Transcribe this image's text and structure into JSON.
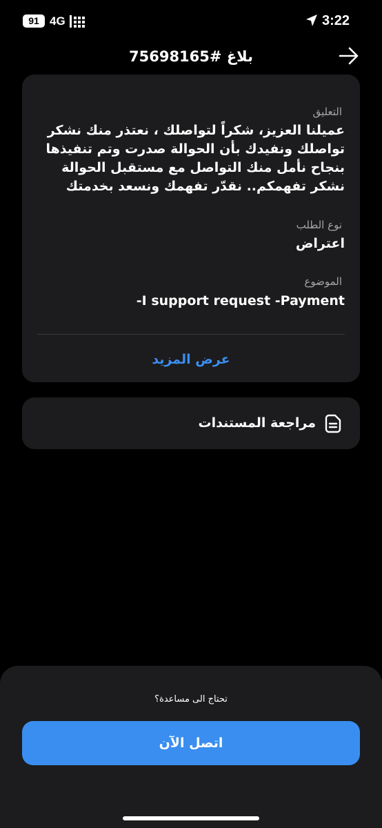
{
  "status_bar": {
    "battery": "91",
    "network": "4G",
    "time": "3:22"
  },
  "header": {
    "title": "بلاغ #75698165",
    "back_icon": "arrow-right-icon"
  },
  "details": {
    "comment_label": "التعليق",
    "comment_text": "عميلنا العزيز، شكراً لتواصلك ، نعتذر منك  نشكر تواصلك ونفيدك بأن الحوالة صدرت وتم تنفيذها بنجاح نأمل منك التواصل مع مستقبل الحوالة نشكر تفهمكم.. نقدّر تفهمك ونسعد بخدمتك",
    "request_type_label": "نوع الطلب",
    "request_type_value": "اعتراض",
    "subject_label": "الموضوع",
    "subject_value": "I support request -Payment-",
    "show_more_label": "عرض المزيد"
  },
  "documents": {
    "label": "مراجعة المستندات",
    "icon": "document-icon"
  },
  "bottom_sheet": {
    "help_text": "تحتاج الى مساعدة؟",
    "contact_button_label": "اتصل الآن"
  },
  "colors": {
    "background": "#000000",
    "card": "#1c1c1e",
    "accent": "#3a8ef0",
    "label_gray": "#a5a5aa"
  }
}
